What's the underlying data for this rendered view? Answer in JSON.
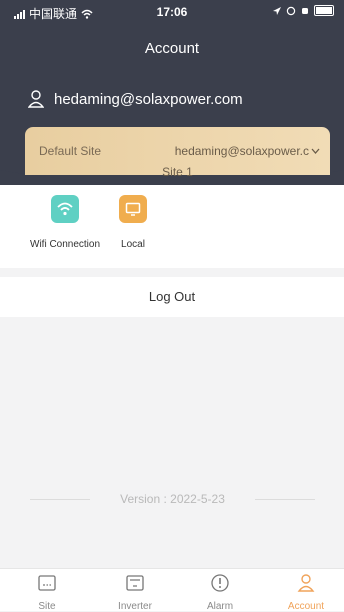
{
  "status_bar": {
    "carrier": "中国联通",
    "time": "17:06"
  },
  "header": {
    "title": "Account",
    "user_email": "hedaming@solaxpower.com"
  },
  "site_card": {
    "label": "Default Site",
    "site_email": "hedaming@solaxpower.c",
    "site_name": "Site 1"
  },
  "tools": [
    {
      "label": "Wifi Connection",
      "icon": "wifi-icon",
      "color": "#5fd0c3"
    },
    {
      "label": "Local",
      "icon": "monitor-icon",
      "color": "#f0ad4e"
    }
  ],
  "logout_label": "Log Out",
  "version_text": "Version : 2022-5-23",
  "tabbar": [
    {
      "label": "Site",
      "icon": "site-icon",
      "active": false
    },
    {
      "label": "Inverter",
      "icon": "inverter-icon",
      "active": false
    },
    {
      "label": "Alarm",
      "icon": "alarm-icon",
      "active": false
    },
    {
      "label": "Account",
      "icon": "account-icon",
      "active": true
    }
  ],
  "colors": {
    "header_bg": "#3b3f4c",
    "accent": "#f0a35a",
    "card_gold": "#e8cea0"
  }
}
